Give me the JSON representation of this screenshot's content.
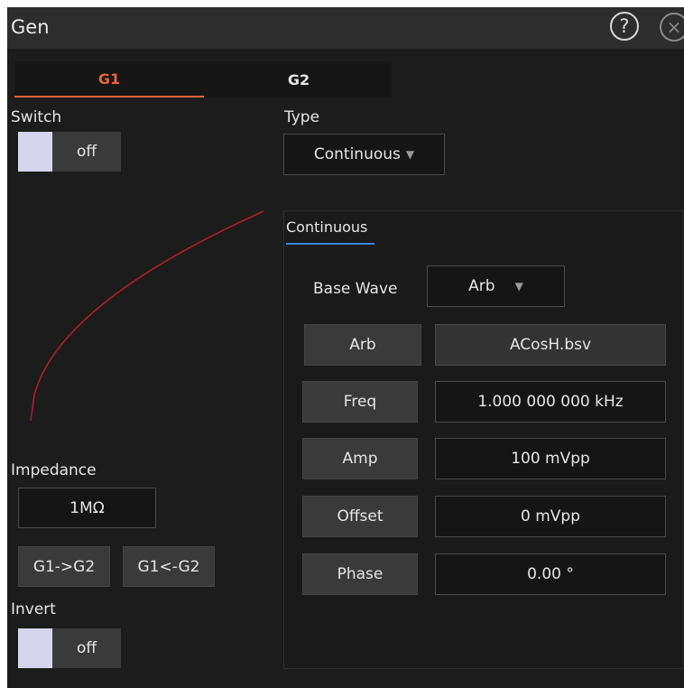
{
  "window": {
    "title": "Gen",
    "help_icon": "?",
    "close_icon": "×"
  },
  "tabs": [
    {
      "label": "G1",
      "active": true
    },
    {
      "label": "G2",
      "active": false
    }
  ],
  "switch": {
    "label": "Switch",
    "state": "off"
  },
  "type": {
    "label": "Type",
    "value": "Continuous",
    "arrow": "▼"
  },
  "panel": {
    "tab_label": "Continuous",
    "base_wave": {
      "label": "Base Wave",
      "value": "Arb",
      "arrow": "▼"
    },
    "params": [
      {
        "label": "Arb",
        "value": "ACosH.bsv"
      },
      {
        "label": "Freq",
        "value": "1.000 000 000 kHz"
      },
      {
        "label": "Amp",
        "value": "100 mVpp"
      },
      {
        "label": "Offset",
        "value": "0 mVpp"
      },
      {
        "label": "Phase",
        "value": "0.00 °"
      }
    ]
  },
  "impedance": {
    "label": "Impedance",
    "value": "1MΩ"
  },
  "copy_buttons": {
    "g1_to_g2": "G1->G2",
    "g1_from_g2": "G1<-G2"
  },
  "invert": {
    "label": "Invert",
    "state": "off"
  },
  "colors": {
    "accent_tab": "#e5643c",
    "panel_tab_underline": "#3a86d8",
    "waveform": "#b01e2a"
  }
}
